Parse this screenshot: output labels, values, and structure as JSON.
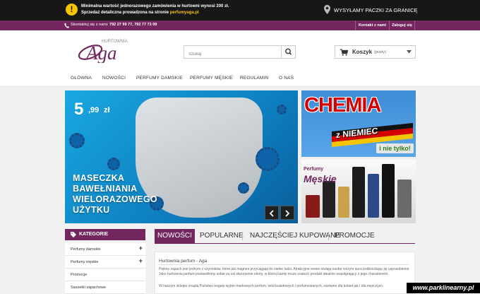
{
  "topbar": {
    "warn_symbol": "!",
    "promo_line1": "Minimalna wartość jednorazowego zamówienia w hurtowni wynosi 200 zł.",
    "promo_line2_text": "Sprzedaż detaliczna prowadzona na stronie ",
    "promo_line2_link": "perfumyaga.pl",
    "shipping": "WYSYŁAMY PACZKI ZA GRANICĘ"
  },
  "contactbar": {
    "contact_label": "Skontaktuj się z nami:",
    "phones": "792 27 99 77, 792 77 73 09",
    "contact_link": "Kontakt z nami",
    "login_link": "Zaloguj się"
  },
  "logo": {
    "small": "HURTOWNIA",
    "big": "Aga"
  },
  "search": {
    "placeholder": "Szukaj"
  },
  "cart": {
    "label": "Koszyk",
    "status": "(pusty)"
  },
  "nav": {
    "items": [
      "GŁÓWNA",
      "NOWOŚCI",
      "PERFUMY DAMSKIE",
      "PERFUMY MĘSKIE",
      "REGULAMIN",
      "O NAS"
    ]
  },
  "slider": {
    "price_int": "5",
    "price_dec": ",99",
    "currency": "zł",
    "lines": [
      "MASECZKA",
      "BAWEŁNIANIA",
      "WIELORAZOWEGO",
      "UŻYTKU"
    ]
  },
  "banner1": {
    "title": "CHEMIA",
    "sub": "z NIEMIEC",
    "tag": "i nie tylko!"
  },
  "banner2": {
    "small": "Perfumy",
    "big": "Męskie"
  },
  "sidebar": {
    "heading": "KATEGORIE",
    "items": [
      {
        "label": "Perfumy damskie",
        "expand": "+"
      },
      {
        "label": "Perfumy męskie",
        "expand": "+"
      },
      {
        "label": "Promocje",
        "expand": ""
      },
      {
        "label": "Saszetki zapachowe",
        "expand": ""
      }
    ]
  },
  "tabs": [
    "NOWOŚCI",
    "POPULARNE",
    "NAJCZĘŚCIEJ KUPOWANE",
    "PROMOCJE"
  ],
  "content": {
    "title": "Hurtownia perfum - Aga",
    "p1": "Piękny zapach jest jednym z czynników, które jak magnes przyciągają do siebie ludzi. Atrakcyjne wonie otulają osobę niczym aura podkreślając jej usposobienie. Jako hurtownia perfum postawiliśmy sobie za cel stworzenie oferty, w której każdy może znaleźć produkt idealnie współgrający z jego charakterem.",
    "p2": "W naszym sklepie znajdą Państwo bogaty wybór markowych perfum, wód toaletowych i perfumowanych, zarówno dla kobiet jak i dla mężczyzn."
  },
  "watermark": "www.parklinearny.pl",
  "colors": {
    "brand": "#74275f",
    "topbar": "#171717",
    "accent": "#f5c400"
  }
}
